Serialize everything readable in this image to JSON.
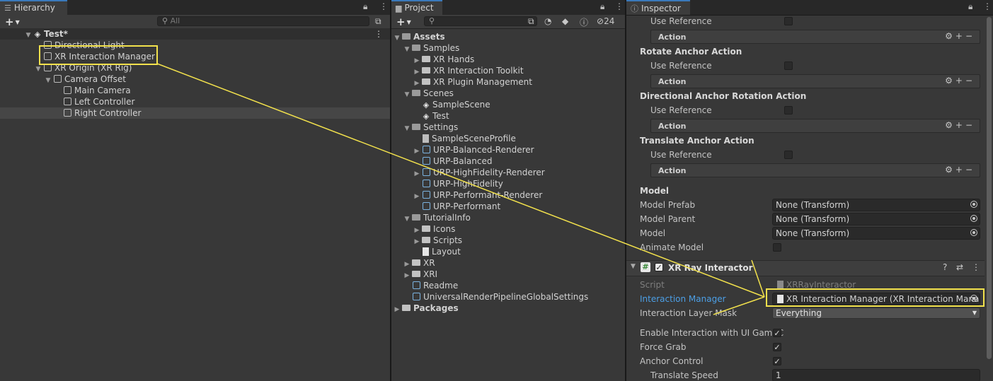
{
  "hierarchy": {
    "tab": "Hierarchy",
    "search_placeholder": "All",
    "scene": "Test*",
    "items": [
      {
        "label": "Directional Light",
        "level": 1,
        "arrow": ""
      },
      {
        "label": "XR Interaction Manager",
        "level": 1,
        "arrow": ""
      },
      {
        "label": "XR Origin (XR Rig)",
        "level": 1,
        "arrow": "▼"
      },
      {
        "label": "Camera Offset",
        "level": 2,
        "arrow": "▼"
      },
      {
        "label": "Main Camera",
        "level": 3,
        "arrow": ""
      },
      {
        "label": "Left Controller",
        "level": 3,
        "arrow": ""
      },
      {
        "label": "Right Controller",
        "level": 3,
        "arrow": ""
      }
    ]
  },
  "project": {
    "tab": "Project",
    "hidden_count": "24",
    "items": [
      {
        "label": "Assets",
        "level": 0,
        "arrow": "▼",
        "icon": "folder-open",
        "bold": true
      },
      {
        "label": "Samples",
        "level": 1,
        "arrow": "▼",
        "icon": "folder-open"
      },
      {
        "label": "XR Hands",
        "level": 2,
        "arrow": "▶",
        "icon": "folder"
      },
      {
        "label": "XR Interaction Toolkit",
        "level": 2,
        "arrow": "▶",
        "icon": "folder"
      },
      {
        "label": "XR Plugin Management",
        "level": 2,
        "arrow": "▶",
        "icon": "folder"
      },
      {
        "label": "Scenes",
        "level": 1,
        "arrow": "▼",
        "icon": "folder-open"
      },
      {
        "label": "SampleScene",
        "level": 2,
        "arrow": "",
        "icon": "unity"
      },
      {
        "label": "Test",
        "level": 2,
        "arrow": "",
        "icon": "unity"
      },
      {
        "label": "Settings",
        "level": 1,
        "arrow": "▼",
        "icon": "folder-open"
      },
      {
        "label": "SampleSceneProfile",
        "level": 2,
        "arrow": "",
        "icon": "profile"
      },
      {
        "label": "URP-Balanced-Renderer",
        "level": 2,
        "arrow": "▶",
        "icon": "asset"
      },
      {
        "label": "URP-Balanced",
        "level": 2,
        "arrow": "",
        "icon": "asset"
      },
      {
        "label": "URP-HighFidelity-Renderer",
        "level": 2,
        "arrow": "▶",
        "icon": "asset"
      },
      {
        "label": "URP-HighFidelity",
        "level": 2,
        "arrow": "",
        "icon": "asset"
      },
      {
        "label": "URP-Performant-Renderer",
        "level": 2,
        "arrow": "▶",
        "icon": "asset"
      },
      {
        "label": "URP-Performant",
        "level": 2,
        "arrow": "",
        "icon": "asset"
      },
      {
        "label": "TutorialInfo",
        "level": 1,
        "arrow": "▼",
        "icon": "folder-open"
      },
      {
        "label": "Icons",
        "level": 2,
        "arrow": "▶",
        "icon": "folder"
      },
      {
        "label": "Scripts",
        "level": 2,
        "arrow": "▶",
        "icon": "folder"
      },
      {
        "label": "Layout",
        "level": 2,
        "arrow": "",
        "icon": "file"
      },
      {
        "label": "XR",
        "level": 1,
        "arrow": "▶",
        "icon": "folder"
      },
      {
        "label": "XRI",
        "level": 1,
        "arrow": "▶",
        "icon": "folder"
      },
      {
        "label": "Readme",
        "level": 1,
        "arrow": "",
        "icon": "asset"
      },
      {
        "label": "UniversalRenderPipelineGlobalSettings",
        "level": 1,
        "arrow": "",
        "icon": "asset"
      },
      {
        "label": "Packages",
        "level": 0,
        "arrow": "▶",
        "icon": "folder",
        "bold": true
      }
    ]
  },
  "inspector": {
    "tab": "Inspector",
    "use_reference": "Use Reference",
    "action_label": "Action",
    "sections": [
      {
        "title": "Rotate Anchor Action"
      },
      {
        "title": "Directional Anchor Rotation Action"
      },
      {
        "title": "Translate Anchor Action"
      }
    ],
    "model": {
      "title": "Model",
      "model_prefab_label": "Model Prefab",
      "model_prefab_value": "None (Transform)",
      "model_parent_label": "Model Parent",
      "model_parent_value": "None (Transform)",
      "model_label": "Model",
      "model_value": "None (Transform)",
      "animate_model_label": "Animate Model"
    },
    "component": {
      "title": "XR Ray Interactor",
      "script_label": "Script",
      "script_value": "XRRayInteractor",
      "interaction_manager_label": "Interaction Manager",
      "interaction_manager_value": "XR Interaction Manager (XR Interaction Manag",
      "layer_mask_label": "Interaction Layer Mask",
      "layer_mask_value": "Everything",
      "enable_ui_label": "Enable Interaction with UI GameC",
      "force_grab_label": "Force Grab",
      "anchor_control_label": "Anchor Control",
      "translate_speed_label": "Translate Speed",
      "translate_speed_value": "1"
    }
  },
  "colors": {
    "highlight": "#f2e14c",
    "tab_accent": "#3a79bb",
    "link_label": "#4c9fe6"
  }
}
